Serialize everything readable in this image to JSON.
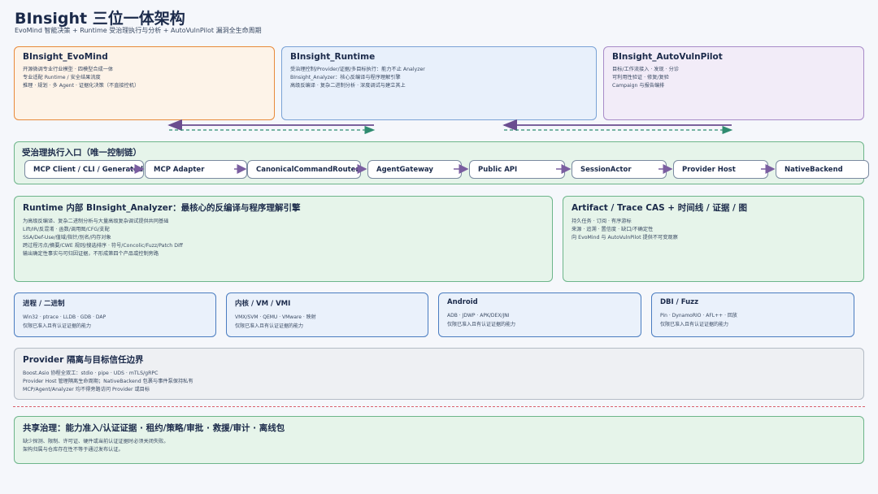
{
  "header": {
    "title": "BInsight 三位一体架构",
    "subtitle": "EvoMind 智能决策 + Runtime 受治理执行与分析 + AutoVulnPilot 漏洞全生命周期"
  },
  "top_boxes": {
    "evomind": {
      "title": "BInsight_EvoMind",
      "lines": [
        "开源微调专业行业模型 · 四模型合成一体",
        "专业适配 Runtime / 安全结果流度",
        "推理 · 规划 · 多 Agent · 证据化决策（不直接控机）"
      ]
    },
    "runtime": {
      "title": "BInsight_Runtime",
      "lines": [
        "受治理控制/Provider/证据/多目标执行：能力不止 Analyzer",
        "BInsight_Analyzer：核心反编译与程序理解引擎",
        "高级反编译 · 复杂二进制分析 · 深度调试与建立其上"
      ]
    },
    "autovuln": {
      "title": "BInsight_AutoVulnPilot",
      "lines": [
        "目标/工作流接入 · 发现 · 分诊",
        "可利用性验证 · 修复/复验",
        "Campaign 与报告编排"
      ]
    }
  },
  "chain": {
    "title": "受治理执行入口（唯一控制链）",
    "nodes": [
      "MCP Client / CLI / Generated",
      "MCP Adapter",
      "CanonicalCommandRouter",
      "AgentGateway",
      "Public API",
      "SessionActor",
      "Provider Host",
      "NativeBackend"
    ]
  },
  "analyzer": {
    "title": "Runtime 内部 BInsight_Analyzer：最核心的反编译与程序理解引擎",
    "lines": [
      "为高级反编译、复杂二进制分析与大量高级复杂调试提供共同基础",
      "Lift/IR/反混淆 · 函数/调用图/CFG/支配",
      "SSA/Def-Use/值域/指针/别名/内存对象",
      "跨过程污点/摘要/CWE 规则/搜选排序 · 符号/Concolic/Fuzz/Patch Diff",
      "输出确定性事实与可归因证据，不形成第四个产品或控制旁路"
    ]
  },
  "artifact": {
    "title": "Artifact / Trace CAS + 时间线 / 证据 / 图",
    "lines": [
      "持久任务 · 订阅 · 有序游标",
      "来源 · 追溯 · 置信度 · 缺口/不确定性",
      "向 EvoMind 与 AutoVulnPilot 提供不可变观察"
    ]
  },
  "small_boxes": [
    {
      "title": "进程 / 二进制",
      "lines": [
        "Win32 · ptrace · LLDB · GDB · DAP",
        "仅限已准入且有认证证据的能力"
      ]
    },
    {
      "title": "内核 / VM / VMI",
      "lines": [
        "VMX/SVM · QEMU · VMware · 映射",
        "仅限已准入且有认证证据的能力"
      ]
    },
    {
      "title": "Android",
      "lines": [
        "ADB · JDWP · APK/DEX/JNI",
        "仅限已准入且有认证证据的能力"
      ]
    },
    {
      "title": "DBI / Fuzz",
      "lines": [
        "Pin · DynamoRIO · AFL++ · 回放",
        "仅限已准入且有认证证据的能力"
      ]
    }
  ],
  "provider": {
    "title": "Provider 隔离与目标信任边界",
    "lines": [
      "Boost.Asio 协程全双工：stdio · pipe · UDS · mTLS/gRPC",
      "Provider Host 管理隔离生命周期；NativeBackend 包裹与事件泵保持私有",
      "MCP/Agent/Analyzer 均不得旁路访问 Provider 或目标"
    ]
  },
  "governance": {
    "title": "共享治理：能力准入/认证证据 · 租约/策略/审批 · 救援/审计 · 离线包",
    "lines": [
      "缺少探测、限制、许可证、硬件或当前认证证据时必须关闭失败。",
      "架构归属与仓库存在性不等于通过发布认证。"
    ]
  },
  "colors": {
    "arrow": "#6b4d8f",
    "arrow_dashed": "#2e8b6f",
    "chain_arrow": "#7a5ea0",
    "divider": "#d8606e"
  }
}
